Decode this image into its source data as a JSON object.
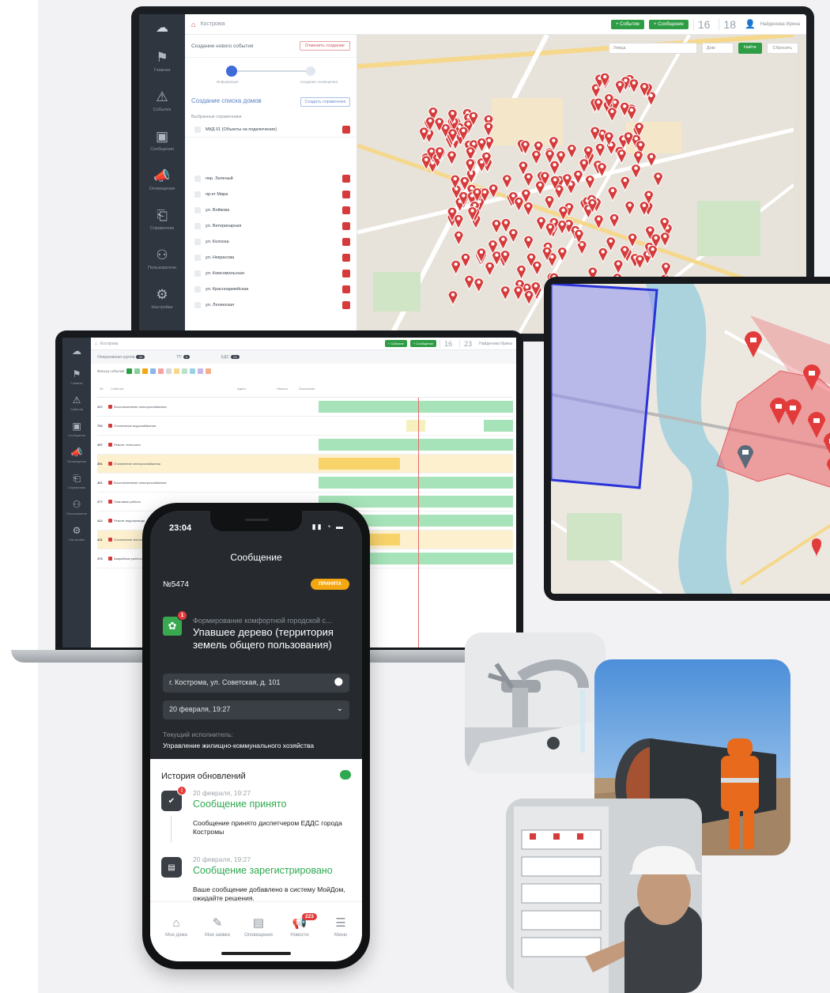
{
  "desktop": {
    "breadcrumb": "Кострома",
    "clock_h": "16",
    "clock_m": "18",
    "top_btn_1": "Событие",
    "top_btn_2": "Сообщение",
    "user": "Найденова Ирина",
    "sidebar": [
      {
        "icon": "flag-icon",
        "glyph": "⚑",
        "label": "Главная"
      },
      {
        "icon": "warning-icon",
        "glyph": "⚠",
        "label": "События"
      },
      {
        "icon": "chat-icon",
        "glyph": "▣",
        "label": "Сообщения"
      },
      {
        "icon": "megaphone-icon",
        "glyph": "📣",
        "label": "Оповещения"
      },
      {
        "icon": "reference-icon",
        "glyph": "⎗",
        "label": "Справочник"
      },
      {
        "icon": "users-icon",
        "glyph": "⚇",
        "label": "Пользователи"
      },
      {
        "icon": "settings-icon",
        "glyph": "⚙",
        "label": "Настройки"
      }
    ],
    "panel_title": "Создание нового события",
    "panel_close": "Отменить создание",
    "step1": "Информация",
    "step2": "Создание оповещения",
    "list_title": "Создание списка домов",
    "list_btn": "Создать справочник",
    "selected_label": "Выбранные справочники",
    "selected_item": "МКД 01 (Объекты на подключение)",
    "streets": [
      "пер. Зеленый",
      "пр-кт Мира",
      "ул. Войкова",
      "ул. Ветеринарная",
      "ул. Колхоза",
      "ул. Некрасова",
      "ул. Комсомольская",
      "ул. Красноармейская",
      "ул. Ленинская"
    ],
    "map_filter_1": "Улица",
    "map_filter_2": "Дом",
    "map_apply": "Найти",
    "map_reset": "Сбросить"
  },
  "laptop": {
    "clock_h": "16",
    "clock_m": "23",
    "tabs": [
      {
        "label": "Оперативная группа",
        "badge": "23"
      },
      {
        "label": "ТП",
        "badge": "9"
      },
      {
        "label": "ЕДС",
        "badge": "23"
      }
    ],
    "filter_label": "Фильтр событий",
    "columns": [
      "№",
      "Событие",
      "Адрес",
      "Начало",
      "Окончание"
    ],
    "rows": [
      {
        "id": "317",
        "title": "Восстановление электроснабжения",
        "highlight": false
      },
      {
        "id": "752",
        "title": "Отключение водоснабжения",
        "highlight": false
      },
      {
        "id": "457",
        "title": "Ремонт теплосети",
        "highlight": false
      },
      {
        "id": "391",
        "title": "Отключение электроснабжения",
        "highlight": true
      },
      {
        "id": "401",
        "title": "Восстановление электроснабжения",
        "highlight": false
      },
      {
        "id": "377",
        "title": "Плановые работы",
        "highlight": false
      },
      {
        "id": "412",
        "title": "Ремонт водопровода",
        "highlight": false
      },
      {
        "id": "431",
        "title": "Отключение теплоснабжения",
        "highlight": true
      },
      {
        "id": "476",
        "title": "Аварийные работы",
        "highlight": false
      }
    ]
  },
  "phone": {
    "time": "23:04",
    "title": "Сообщение",
    "number": "№5474",
    "status": "ПРИНЯТА",
    "category_badge": "1",
    "category": "Формирование комфортной городской с...",
    "message_title": "Упавшее дерево (территория земель общего пользования)",
    "address": "г. Кострома, ул. Советская, д. 101",
    "date": "20 февраля, 19:27",
    "executor_label": "Текущий исполнитель:",
    "executor": "Управление жилищно-коммунального хозяйства",
    "history_title": "История обновлений",
    "history": [
      {
        "date": "20 февраля, 19:27",
        "title": "Сообщение принято",
        "text": "Сообщение принято диспетчером ЕДДС города Костромы"
      },
      {
        "date": "20 февраля, 19:27",
        "title": "Сообщение зарегистрировано",
        "text": "Ваше сообщение добавлено в систему МойДом, ожидайте решения."
      }
    ],
    "nav": [
      {
        "icon": "home-icon",
        "glyph": "⌂",
        "label": "Мои дома"
      },
      {
        "icon": "edit-icon",
        "glyph": "✎",
        "label": "Мои заявки"
      },
      {
        "icon": "list-icon",
        "glyph": "▤",
        "label": "Оповещения"
      },
      {
        "icon": "megaphone-icon",
        "glyph": "📢",
        "label": "Новости",
        "badge": "223"
      },
      {
        "icon": "menu-icon",
        "glyph": "☰",
        "label": "Меню"
      }
    ]
  },
  "colors": {
    "accent_green": "#2ea94f",
    "alert_red": "#d63b3b",
    "status_orange": "#f3a712",
    "dark_ui": "#2f3640"
  }
}
